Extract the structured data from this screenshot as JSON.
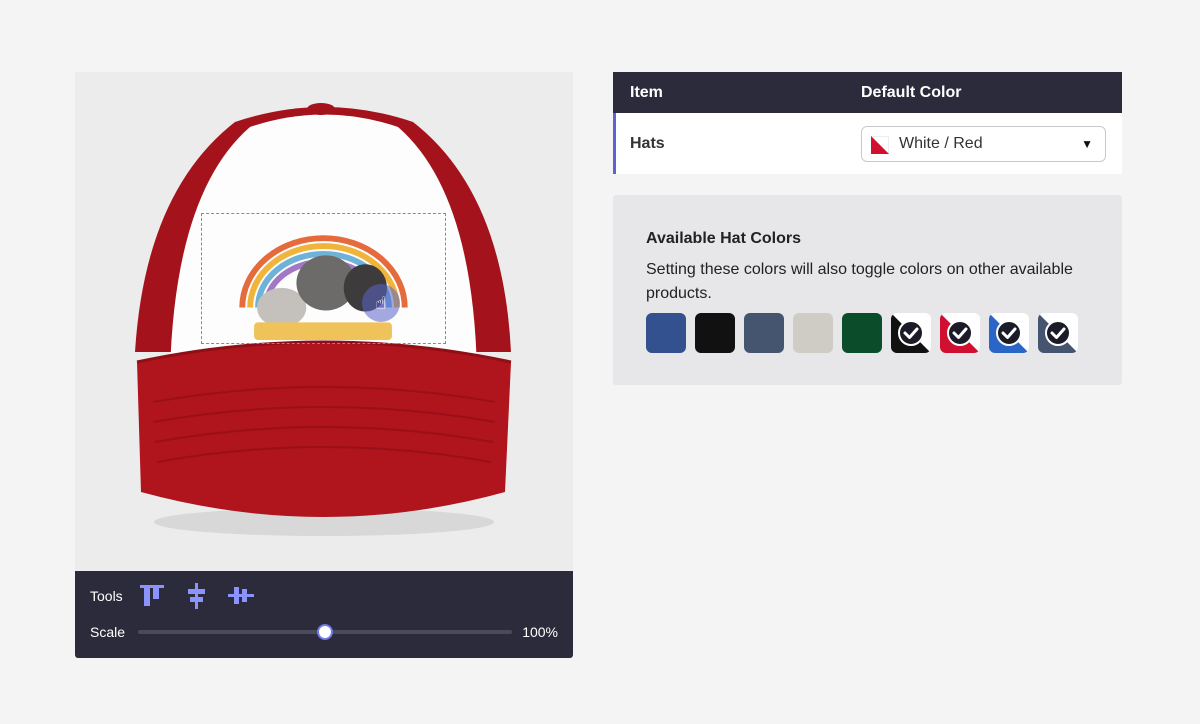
{
  "tools_bar": {
    "tools_label": "Tools",
    "scale_label": "Scale",
    "scale_value": "100%",
    "scale_fraction": 0.5,
    "tool_icons": [
      "align-top-icon",
      "align-vertical-center-icon",
      "align-horizontal-center-icon"
    ]
  },
  "table": {
    "headers": {
      "item": "Item",
      "default_color": "Default Color"
    },
    "row": {
      "label": "Hats",
      "selected_color": "White / Red"
    }
  },
  "colors_panel": {
    "title": "Available Hat Colors",
    "description": "Setting these colors will also toggle colors on other available products.",
    "swatches": [
      {
        "name": "royal-blue",
        "color": "#33508f",
        "selected": false
      },
      {
        "name": "black",
        "color": "#111111",
        "selected": false
      },
      {
        "name": "slate",
        "color": "#46556f",
        "selected": false
      },
      {
        "name": "light-gray",
        "color": "#cfcbc5",
        "selected": false
      },
      {
        "name": "green",
        "color": "#0b4d2a",
        "selected": false
      },
      {
        "name": "white-black",
        "color": "#111111",
        "selected": true
      },
      {
        "name": "white-red",
        "color": "#d01030",
        "selected": true
      },
      {
        "name": "white-royal",
        "color": "#2a66c7",
        "selected": true
      },
      {
        "name": "white-slate",
        "color": "#46556f",
        "selected": true
      }
    ]
  },
  "colors": {
    "accent": "#5c63d6",
    "dark": "#2b2b3b",
    "hat_red": "#b0141d"
  }
}
